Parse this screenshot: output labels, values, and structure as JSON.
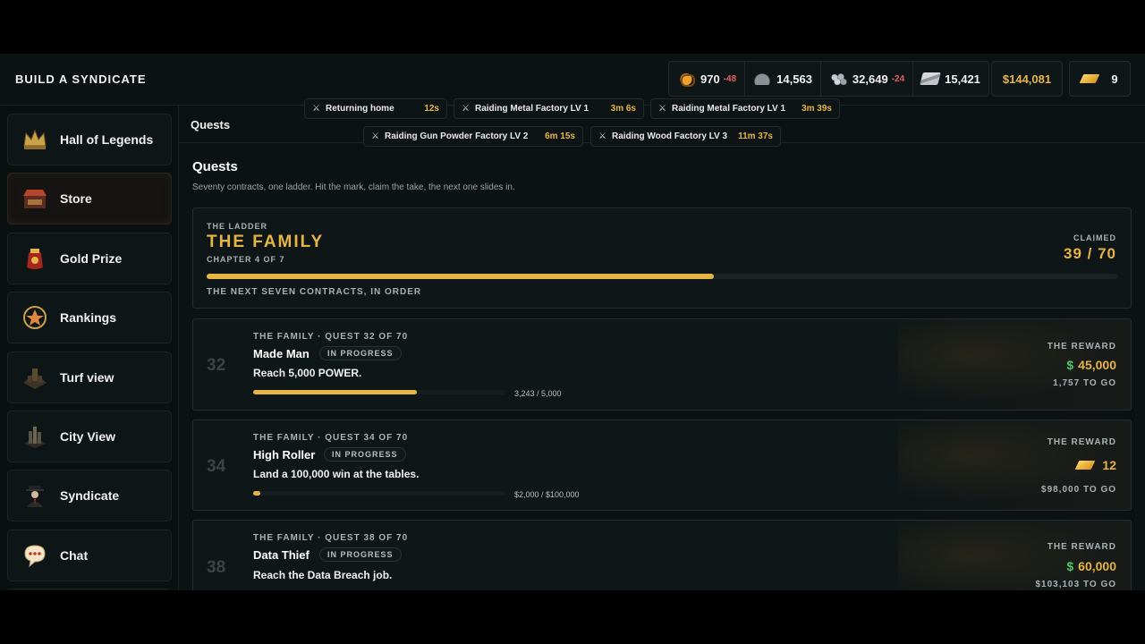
{
  "app": {
    "title": "BUILD A SYNDICATE"
  },
  "resources": [
    {
      "icon": "food-icon",
      "value": "970",
      "delta": "-48"
    },
    {
      "icon": "stone-icon",
      "value": "14,563",
      "delta": ""
    },
    {
      "icon": "metal-icon",
      "value": "32,649",
      "delta": "-24"
    },
    {
      "icon": "steel-icon",
      "value": "15,421",
      "delta": ""
    }
  ],
  "cash": "$144,081",
  "gold": {
    "icon": "gold-bar-icon",
    "value": "9"
  },
  "sidebar": {
    "items": [
      {
        "label": "Hall of Legends",
        "icon": "crown-icon"
      },
      {
        "label": "Store",
        "icon": "store-icon"
      },
      {
        "label": "Gold Prize",
        "icon": "gold-prize-icon"
      },
      {
        "label": "Rankings",
        "icon": "rankings-icon"
      },
      {
        "label": "Turf view",
        "icon": "turf-icon"
      },
      {
        "label": "City View",
        "icon": "city-icon"
      },
      {
        "label": "Syndicate",
        "icon": "syndicate-icon"
      },
      {
        "label": "Chat",
        "icon": "chat-icon"
      }
    ]
  },
  "breadcrumb": "Quests",
  "activities": [
    {
      "label": "Returning home",
      "time": "12s"
    },
    {
      "label": "Raiding Metal Factory LV 1",
      "time": "3m 6s"
    },
    {
      "label": "Raiding Metal Factory LV 1",
      "time": "3m 39s"
    },
    {
      "label": "Raiding Gun Powder Factory LV 2",
      "time": "6m 15s"
    },
    {
      "label": "Raiding Wood Factory LV 3",
      "time": "11m 37s"
    }
  ],
  "page": {
    "title": "Quests",
    "subtitle": "Seventy contracts, one ladder. Hit the mark, claim the take, the next one slides in."
  },
  "ladder": {
    "kicker": "THE LADDER",
    "name": "THE FAMILY",
    "chapter": "CHAPTER 4 OF 7",
    "claimed_label": "CLAIMED",
    "claimed": "39 / 70",
    "progress": 0.557,
    "next_label": "THE NEXT SEVEN CONTRACTS, IN ORDER"
  },
  "quests": [
    {
      "number": "32",
      "kicker": "THE FAMILY · QUEST 32 OF 70",
      "name": "Made Man",
      "status": "IN PROGRESS",
      "description": "Reach 5,000 POWER.",
      "progress": 0.649,
      "progress_text": "3,243 / 5,000",
      "reward_label": "THE REWARD",
      "reward_prefix": "$",
      "reward": "45,000",
      "to_go": "1,757 TO GO"
    },
    {
      "number": "34",
      "kicker": "THE FAMILY · QUEST 34 OF 70",
      "name": "High Roller",
      "status": "IN PROGRESS",
      "description": "Land a 100,000 win at the tables.",
      "progress": 0.02,
      "progress_text": "$2,000 / $100,000",
      "reward_label": "THE REWARD",
      "reward_prefix": "",
      "reward": "12",
      "reward_icon": "gold-bar-icon",
      "to_go": "$98,000 TO GO"
    },
    {
      "number": "38",
      "kicker": "THE FAMILY · QUEST 38 OF 70",
      "name": "Data Thief",
      "status": "IN PROGRESS",
      "description": "Reach the Data Breach job.",
      "progress": 0,
      "progress_text": "",
      "reward_label": "THE REWARD",
      "reward_prefix": "$",
      "reward": "60,000",
      "to_go": "$103,103 TO GO"
    }
  ],
  "colors": {
    "accent": "#e7b544",
    "money": "#4fc86a",
    "negative": "#e45d5d",
    "background": "#0c1213"
  }
}
